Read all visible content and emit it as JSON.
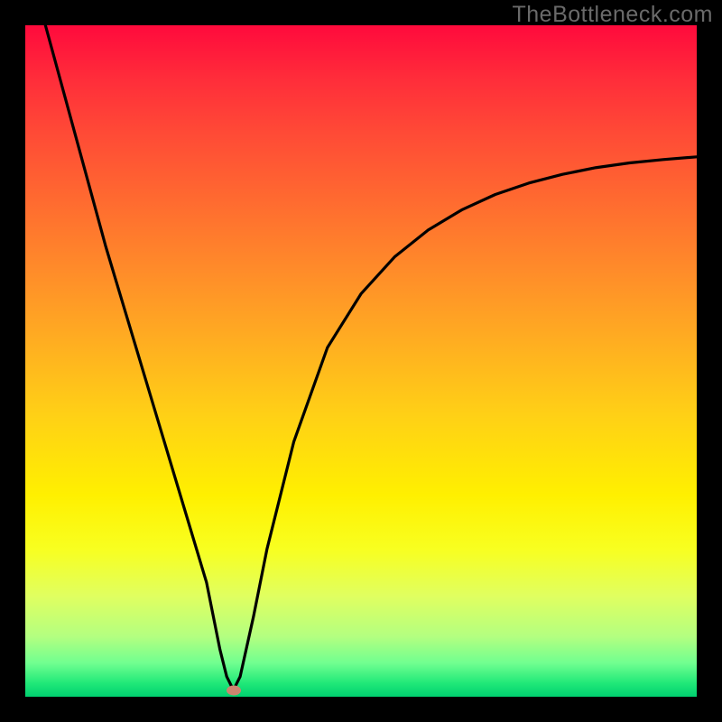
{
  "watermark": "TheBottleneck.com",
  "chart_data": {
    "type": "line",
    "title": "",
    "xlabel": "",
    "ylabel": "",
    "xlim": [
      0,
      100
    ],
    "ylim": [
      0,
      100
    ],
    "grid": false,
    "legend": false,
    "background_gradient": {
      "top": "#ff0a3c",
      "mid": "#fff000",
      "bottom": "#00d070"
    },
    "series": [
      {
        "name": "bottleneck-curve",
        "color": "#000000",
        "x": [
          3,
          6,
          9,
          12,
          15,
          18,
          21,
          24,
          27,
          29,
          30,
          31,
          32,
          34,
          36,
          40,
          45,
          50,
          55,
          60,
          65,
          70,
          75,
          80,
          85,
          90,
          95,
          100
        ],
        "y": [
          100,
          89,
          78,
          67,
          57,
          47,
          37,
          27,
          17,
          7,
          3,
          1,
          3,
          12,
          22,
          38,
          52,
          60,
          65.5,
          69.5,
          72.5,
          74.8,
          76.5,
          77.8,
          78.8,
          79.5,
          80,
          80.4
        ]
      }
    ],
    "marker": {
      "x": 31,
      "y": 1,
      "color": "#cc8570"
    }
  }
}
